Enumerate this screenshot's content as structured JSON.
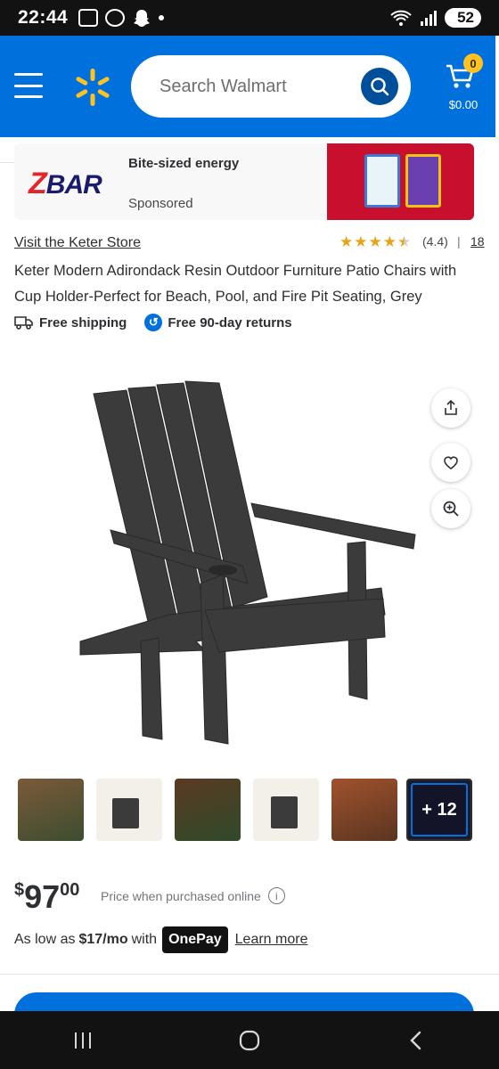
{
  "status_bar": {
    "time": "22:44",
    "battery": "52"
  },
  "header": {
    "search_placeholder": "Search Walmart",
    "cart_count": "0",
    "cart_total": "$0.00",
    "colors": {
      "brand_blue": "#0071dc",
      "spark_yellow": "#ffc220"
    }
  },
  "ad": {
    "brand": "ZBAR",
    "title": "Bite-sized energy",
    "sponsored": "Sponsored"
  },
  "product": {
    "store_link": "Visit the Keter Store",
    "rating": "(4.4)",
    "rating_value": 4.4,
    "review_count": "18",
    "title": "Keter Modern Adirondack Resin Outdoor Furniture Patio Chairs with Cup Holder-Perfect for Beach, Pool, and Fire Pit Seating, Grey",
    "perks": {
      "shipping": "Free shipping",
      "returns": "Free 90-day returns"
    },
    "more_images": "+ 12",
    "price": {
      "currency": "$",
      "dollars": "97",
      "cents": "00"
    },
    "price_note": "Price when purchased online",
    "onepay": {
      "prefix": "As low as",
      "amount": "$17/mo",
      "with": "with",
      "badge": "OnePay",
      "learn_more": "Learn more"
    }
  },
  "icons": {
    "menu": "hamburger-menu-icon",
    "logo": "walmart-spark-icon",
    "search": "search-icon",
    "cart": "cart-icon",
    "share": "share-icon",
    "favorite": "heart-icon",
    "zoom": "zoom-in-icon",
    "shipping": "truck-icon",
    "returns": "return-icon",
    "info": "info-icon"
  }
}
